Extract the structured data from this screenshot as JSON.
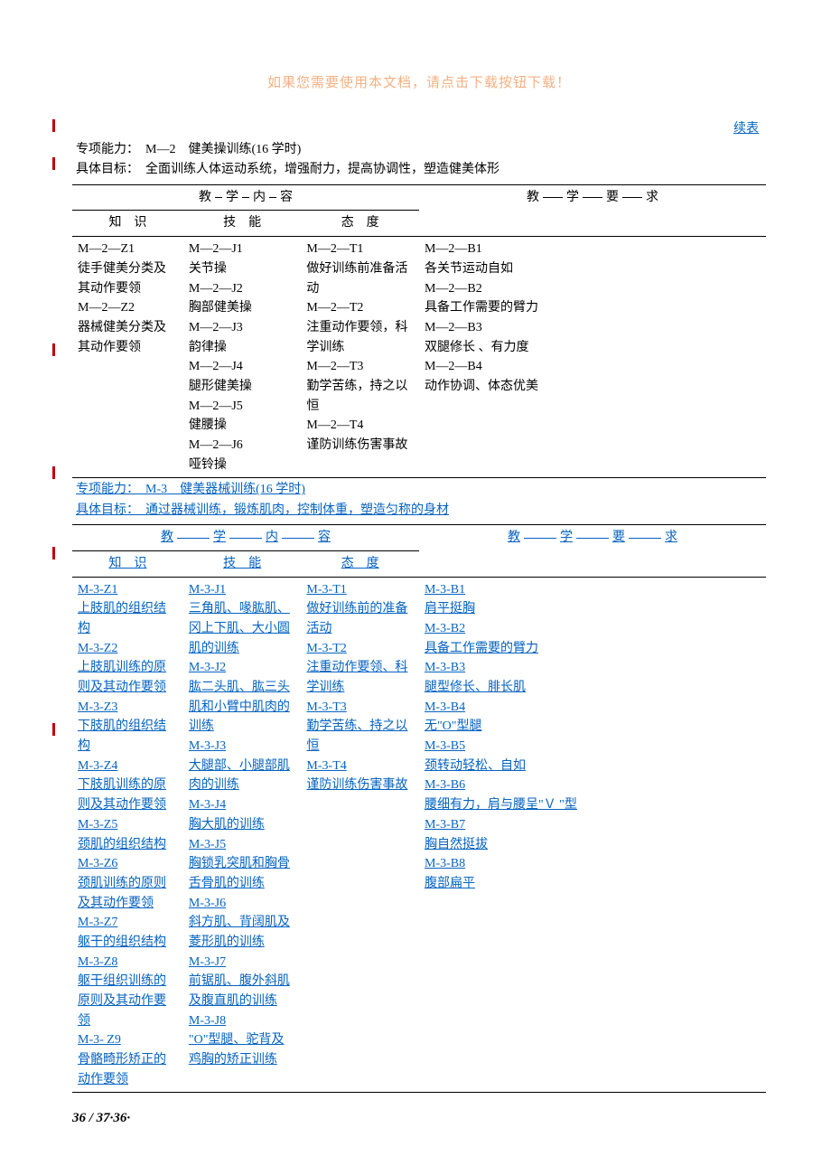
{
  "header_note": "如果您需要使用本文档，请点击下载按钮下载！",
  "continued_label": "续表",
  "section_m2": {
    "title_label": "专项能力：",
    "title_code": "M—2",
    "title_name": "健美操训练(16 学时)",
    "goal_label": "具体目标：",
    "goal_text": "全面训练人体运动系统，增强耐力，提高协调性，塑造健美体形",
    "hdr_main": [
      "教",
      "学",
      "内",
      "容"
    ],
    "hdr_req": [
      "教",
      "学",
      "要",
      "求"
    ],
    "hdr_sub": {
      "z": "知　识",
      "j": "技　能",
      "t": "态　度"
    },
    "col_z": [
      "M—2—Z1",
      "徒手健美分类及其动作要领",
      "M—2—Z2",
      "器械健美分类及其动作要领"
    ],
    "col_j": [
      "M—2—J1",
      "关节操",
      "M—2—J2",
      "胸部健美操",
      "M—2—J3",
      "韵律操",
      "M—2—J4",
      "腿形健美操",
      "M—2—J5",
      "健腰操",
      "M—2—J6",
      "哑铃操"
    ],
    "col_t": [
      "M—2—T1",
      "做好训练前准备活动",
      "M—2—T2",
      "注重动作要领，科学训练",
      "M—2—T3",
      "勤学苦练，持之以恒",
      "M—2—T4",
      "谨防训练伤害事故"
    ],
    "col_b": [
      "M—2—B1",
      "各关节运动自如",
      "M—2—B2",
      "具备工作需要的臂力",
      "M—2—B3",
      "双腿修长 、有力度",
      "M—2—B4",
      "动作协调、体态优美"
    ]
  },
  "section_m3": {
    "title_label": "专项能力：",
    "title_code": "M-3",
    "title_name": "健美器械训练(16 学时)",
    "goal_label": "具体目标：",
    "goal_text": "通过器械训练，锻炼肌肉，控制体重，塑造匀称的身材",
    "hdr_main": [
      "教",
      "学",
      "内",
      "容"
    ],
    "hdr_req": [
      "教",
      "学",
      "要",
      "求"
    ],
    "hdr_sub": {
      "z": "知　识",
      "j": "技　能",
      "t": "态　度"
    },
    "col_z": [
      "M-3-Z1",
      "上肢肌的组织结构",
      "M-3-Z2",
      "上肢肌训练的原则及其动作要领",
      "M-3-Z3",
      "下肢肌的组织结构",
      "M-3-Z4",
      "下肢肌训练的原则及其动作要领",
      "M-3-Z5",
      "颈肌的组织结构",
      "M-3-Z6",
      "颈肌训练的原则及其动作要领",
      "M-3-Z7",
      "躯干的组织结构",
      "M-3-Z8",
      "躯干组织训练的原则及其动作要领",
      "M-3- Z9",
      "骨骼畸形矫正的动作要领"
    ],
    "col_j": [
      "M-3-J1",
      "三角肌、喙肱肌、冈上下肌、大小圆肌的训练",
      "M-3-J2",
      "肱二头肌、肱三头肌和小臂中肌肉的训练",
      "M-3-J3",
      "大腿部、小腿部肌肉的训练",
      "M-3-J4",
      "胸大肌的训练",
      "M-3-J5",
      "胸锁乳突肌和胸骨舌骨肌的训练",
      "M-3-J6",
      "斜方肌、背阔肌及菱形肌的训练",
      "M-3-J7",
      "前锯肌、腹外斜肌及腹直肌的训练",
      "M-3-J8",
      "\"O\"型腿、驼背及鸡胸的矫正训练"
    ],
    "col_t": [
      "M-3-T1",
      "做好训练前的准备活动",
      "M-3-T2",
      "注重动作要领、科学训练",
      "M-3-T3",
      "勤学苦练、持之以恒",
      "M-3-T4",
      "谨防训练伤害事故"
    ],
    "col_b": [
      "M-3-B1",
      "肩平挺胸",
      "M-3-B2",
      "具备工作需要的臂力",
      "M-3-B3",
      "腿型修长、腓长肌",
      "M-3-B4",
      "无\"O\"型腿",
      "M-3-B5",
      "颈转动轻松、自如",
      "M-3-B6",
      "腰细有力，肩与腰呈\"Ｖ \"型",
      "M-3-B7",
      "胸自然挺拔",
      "M-3-B8",
      "腹部扁平"
    ]
  },
  "footer": "36 / 37·36·"
}
